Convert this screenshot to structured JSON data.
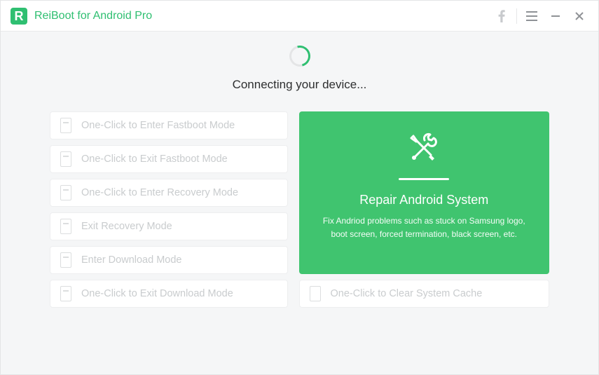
{
  "app": {
    "title": "ReiBoot for Android Pro",
    "logo_letter": "R"
  },
  "status": {
    "text": "Connecting your device..."
  },
  "modes": {
    "enter_fastboot": "One-Click to Enter Fastboot Mode",
    "exit_fastboot": "One-Click to Exit Fastboot Mode",
    "enter_recovery": "One-Click to Enter Recovery Mode",
    "exit_recovery": "Exit Recovery Mode",
    "enter_download": "Enter Download Mode",
    "exit_download": "One-Click to Exit Download Mode"
  },
  "repair": {
    "title": "Repair Android System",
    "desc": "Fix Andriod problems such as stuck on Samsung logo, boot screen, forced termination, black screen, etc."
  },
  "clear_cache": {
    "label": "One-Click to Clear System Cache"
  },
  "colors": {
    "accent": "#2fbf71",
    "repair_bg": "#40c46f"
  }
}
